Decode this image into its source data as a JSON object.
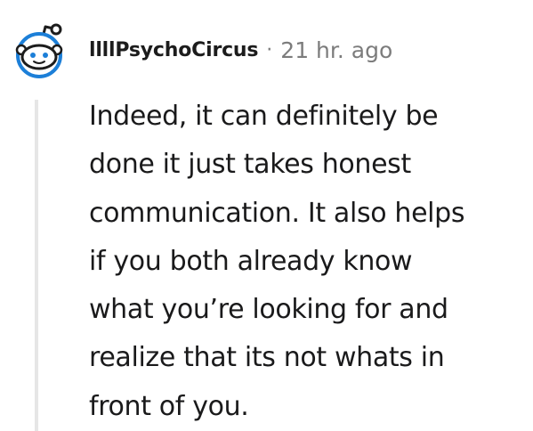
{
  "comment": {
    "username": "llllPsychoCircus",
    "separator": "·",
    "timestamp": "21 hr. ago",
    "body_lines": [
      "Indeed, it can definitely be",
      "done it just takes honest",
      "communication. It also helps",
      "if you both already know",
      "what you’re looking for and",
      "realize that its not whats in",
      "front of you."
    ],
    "avatar_icon": "reddit-snoo-avatar-icon",
    "colors": {
      "avatar_ring": "#1c7fd8",
      "muted_text": "#7c7c7c",
      "thread_line": "#e6e6e6"
    }
  }
}
